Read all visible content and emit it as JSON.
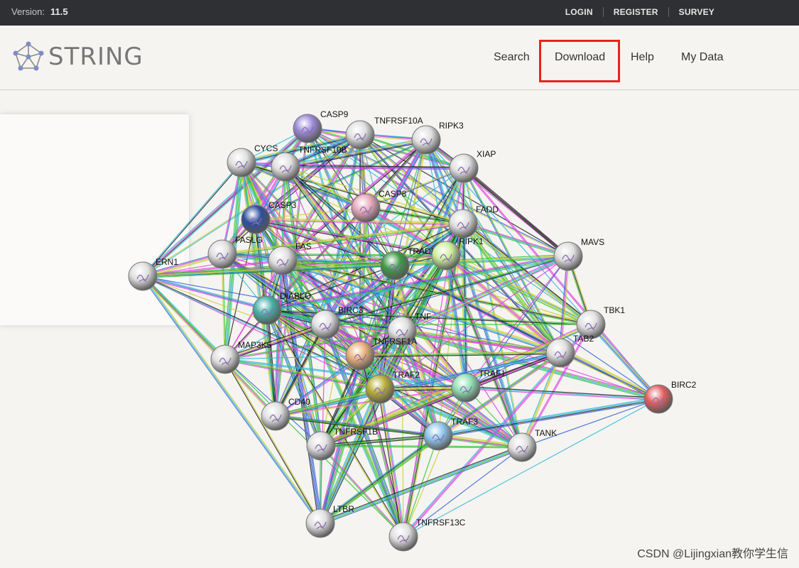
{
  "topbar": {
    "version_label": "Version:",
    "version_value": "11.5",
    "links": [
      "LOGIN",
      "REGISTER",
      "SURVEY"
    ]
  },
  "header": {
    "logo_text": "STRING",
    "nav": [
      "Search",
      "Download",
      "Help",
      "My Data"
    ]
  },
  "network": {
    "edge_colors": [
      "#c9cc34",
      "#e040e0",
      "#2bb8d8",
      "#222222",
      "#33c233",
      "#3b64d6"
    ],
    "nodes": [
      {
        "label": "CASP9",
        "color": "#9b8ad8"
      },
      {
        "label": "TNFRSF10A",
        "color": "#e0e0e0"
      },
      {
        "label": "RIPK3",
        "color": "#e0e0e0"
      },
      {
        "label": "XIAP",
        "color": "#e0e0e0"
      },
      {
        "label": "CYCS",
        "color": "#e0e0e0"
      },
      {
        "label": "TNFRSF10B",
        "color": "#e0e0e0"
      },
      {
        "label": "CASP8",
        "color": "#e7a8bb"
      },
      {
        "label": "CASP3",
        "color": "#2f4e9c"
      },
      {
        "label": "FADD",
        "color": "#e0e0e0"
      },
      {
        "label": "FASLG",
        "color": "#e0e0e0"
      },
      {
        "label": "FAS",
        "color": "#e0e0e0"
      },
      {
        "label": "TRADD",
        "color": "#3f9a48"
      },
      {
        "label": "RIPK1",
        "color": "#cdee9c"
      },
      {
        "label": "MAVS",
        "color": "#e0e0e0"
      },
      {
        "label": "ERN1",
        "color": "#e0e0e0"
      },
      {
        "label": "DIABLO",
        "color": "#48b0a6"
      },
      {
        "label": "BIRC3",
        "color": "#e0e0e0"
      },
      {
        "label": "TNF",
        "color": "#e0e0e0"
      },
      {
        "label": "TBK1",
        "color": "#e0e0e0"
      },
      {
        "label": "MAP3K5",
        "color": "#e0e0e0"
      },
      {
        "label": "TNFRSF1A",
        "color": "#e8b07a"
      },
      {
        "label": "TAB2",
        "color": "#e0e0e0"
      },
      {
        "label": "TRAF2",
        "color": "#b8ae38"
      },
      {
        "label": "TRAF1",
        "color": "#92e0b6"
      },
      {
        "label": "BIRC2",
        "color": "#e06060"
      },
      {
        "label": "CD40",
        "color": "#e0e0e0"
      },
      {
        "label": "TRAF3",
        "color": "#8ec6ea"
      },
      {
        "label": "TNFRSF1B",
        "color": "#e0e0e0"
      },
      {
        "label": "TANK",
        "color": "#e0e0e0"
      },
      {
        "label": "LTBR",
        "color": "#e0e0e0"
      },
      {
        "label": "TNFRSF13C",
        "color": "#e0e0e0"
      }
    ]
  },
  "watermark": "CSDN @Lijingxian教你学生信"
}
